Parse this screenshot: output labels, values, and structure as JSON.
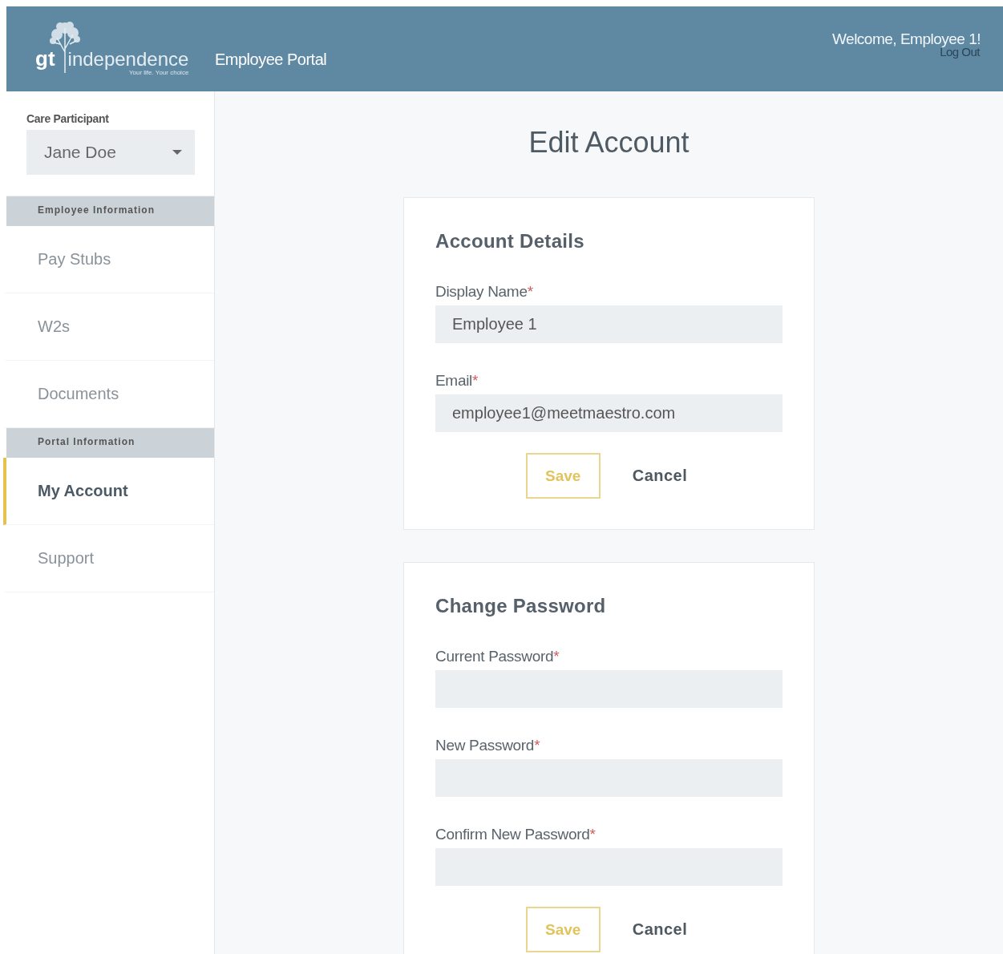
{
  "header": {
    "logo": {
      "mark": "gt",
      "name": "independence",
      "tagline": "Your life. Your choice"
    },
    "portal_title": "Employee Portal",
    "welcome": "Welcome, Employee 1!",
    "logout": "Log Out"
  },
  "sidebar": {
    "participant_label": "Care Participant",
    "participant": "Jane Doe",
    "sections": [
      {
        "heading": "Employee Information",
        "items": [
          {
            "label": "Pay Stubs",
            "selected": false
          },
          {
            "label": "W2s",
            "selected": false
          },
          {
            "label": "Documents",
            "selected": false
          }
        ]
      },
      {
        "heading": "Portal Information",
        "items": [
          {
            "label": "My Account",
            "selected": true
          },
          {
            "label": "Support",
            "selected": false
          }
        ]
      }
    ]
  },
  "page_title": "Edit Account",
  "cards": [
    {
      "title": "Account Details",
      "fields": [
        {
          "label": "Display Name",
          "required_mark": "*",
          "value": "Employee 1"
        },
        {
          "label": "Email",
          "required_mark": "*",
          "value": "employee1@meetmaestro.com"
        }
      ],
      "save": "Save",
      "cancel": "Cancel"
    },
    {
      "title": "Change Password",
      "fields": [
        {
          "label": "Current Password",
          "required_mark": "*"
        },
        {
          "label": "New Password",
          "required_mark": "*"
        },
        {
          "label": "Confirm New Password",
          "required_mark": "*"
        }
      ],
      "save": "Save",
      "cancel": "Cancel"
    }
  ]
}
